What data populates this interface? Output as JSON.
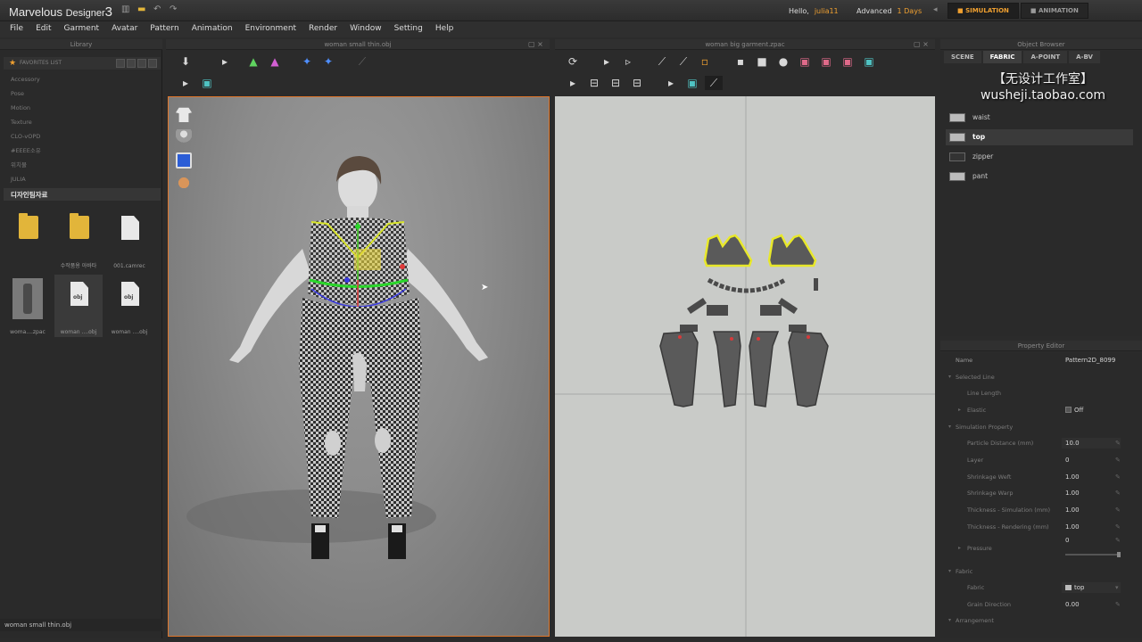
{
  "app": {
    "title_main": "Marvelous",
    "title_sub": "Designer",
    "title_ver": "3",
    "hello_label": "Hello,",
    "user": "julia11",
    "license_label": "Advanced",
    "days_left": "1 Days",
    "mode_simulation": "SIMULATION",
    "mode_animation": "ANIMATION",
    "accent_color": "#f0a030",
    "viewport_border_color": "#e0762a"
  },
  "menu": [
    "File",
    "Edit",
    "Garment",
    "Avatar",
    "Pattern",
    "Animation",
    "Environment",
    "Render",
    "Window",
    "Setting",
    "Help"
  ],
  "library": {
    "header": "Library",
    "favorites_label": "FAVORITES LIST",
    "items": [
      "Accessory",
      "Pose",
      "Motion",
      "Texture",
      "CLO-vOPD",
      "#EEEE소유",
      "위치물",
      "JULIA"
    ],
    "active_item": "디자인팀자료",
    "files": [
      {
        "label": "",
        "kind": "folder"
      },
      {
        "label": "수작품용 아바타",
        "kind": "folder"
      },
      {
        "label": "001.camrec",
        "kind": "doc"
      },
      {
        "label": "woma....zpac",
        "kind": "thumb"
      },
      {
        "label": "woman ....obj",
        "kind": "obj"
      },
      {
        "label": "woman ....obj",
        "kind": "obj"
      }
    ],
    "status": "woman small thin.obj"
  },
  "view3d": {
    "title": "woman small thin.obj"
  },
  "view2d": {
    "title": "woman big garment.zpac"
  },
  "object_browser": {
    "header": "Object Browser",
    "tabs": [
      "SCENE",
      "FABRIC",
      "A-POINT",
      "A-BV"
    ],
    "watermark_line1": "【无设计工作室】",
    "watermark_line2": "wusheji.taobao.com",
    "items": [
      {
        "name": "waist",
        "selected": false
      },
      {
        "name": "top",
        "selected": true
      },
      {
        "name": "zipper",
        "selected": false
      },
      {
        "name": "pant",
        "selected": false
      }
    ]
  },
  "property_editor": {
    "header": "Property Editor",
    "name_label": "Name",
    "name_value": "Pattern2D_8099",
    "selected_line": "Selected Line",
    "line_length": "Line Length",
    "elastic": "Elastic",
    "elastic_value": "Off",
    "sim_property": "Simulation Property",
    "particle_distance": "Particle Distance (mm)",
    "particle_distance_value": "10.0",
    "layer": "Layer",
    "layer_value": "0",
    "shrink_weft": "Shrinkage Weft",
    "shrink_weft_value": "1.00",
    "shrink_warp": "Shrinkage Warp",
    "shrink_warp_value": "1.00",
    "thick_sim": "Thickness - Simulation (mm)",
    "thick_sim_value": "1.00",
    "thick_render": "Thickness - Rendering (mm)",
    "thick_render_value": "1.00",
    "pressure": "Pressure",
    "pressure_value": "0",
    "fabric_section": "Fabric",
    "fabric": "Fabric",
    "fabric_value": "top",
    "grain_direction": "Grain Direction",
    "grain_direction_value": "0.00",
    "arrangement": "Arrangement"
  }
}
